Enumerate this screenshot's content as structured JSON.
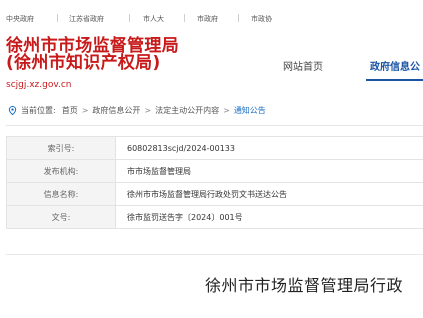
{
  "topbar": {
    "links": [
      "中央政府",
      "江苏省政府",
      "市人大",
      "市政府",
      "市政协"
    ]
  },
  "brand": {
    "line1": "徐州市市场监督管理局",
    "line2": "(徐州市知识产权局)",
    "url": "scjgj.xz.gov.cn"
  },
  "nav": {
    "items": [
      "网站首页",
      "政府信息公"
    ],
    "active_index": 1
  },
  "breadcrumb": {
    "label": "当前位置:",
    "items": [
      "首页",
      "政府信息公开",
      "法定主动公开内容",
      "通知公告"
    ]
  },
  "meta_table": {
    "rows": [
      {
        "key": "索引号:",
        "value": "60802813scjd/2024-00133"
      },
      {
        "key": "发布机构:",
        "value": "市市场监督管理局"
      },
      {
        "key": "信息名称:",
        "value": "徐州市市场监督管理局行政处罚文书送达公告"
      },
      {
        "key": "文号:",
        "value": "徐市监罚送告字〔2024〕001号"
      }
    ]
  },
  "document": {
    "title": "徐州市市场监督管理局行政"
  },
  "colors": {
    "brand_red": "#c81a1a",
    "nav_blue": "#1a55a4",
    "link_blue": "#1a6fc4"
  }
}
